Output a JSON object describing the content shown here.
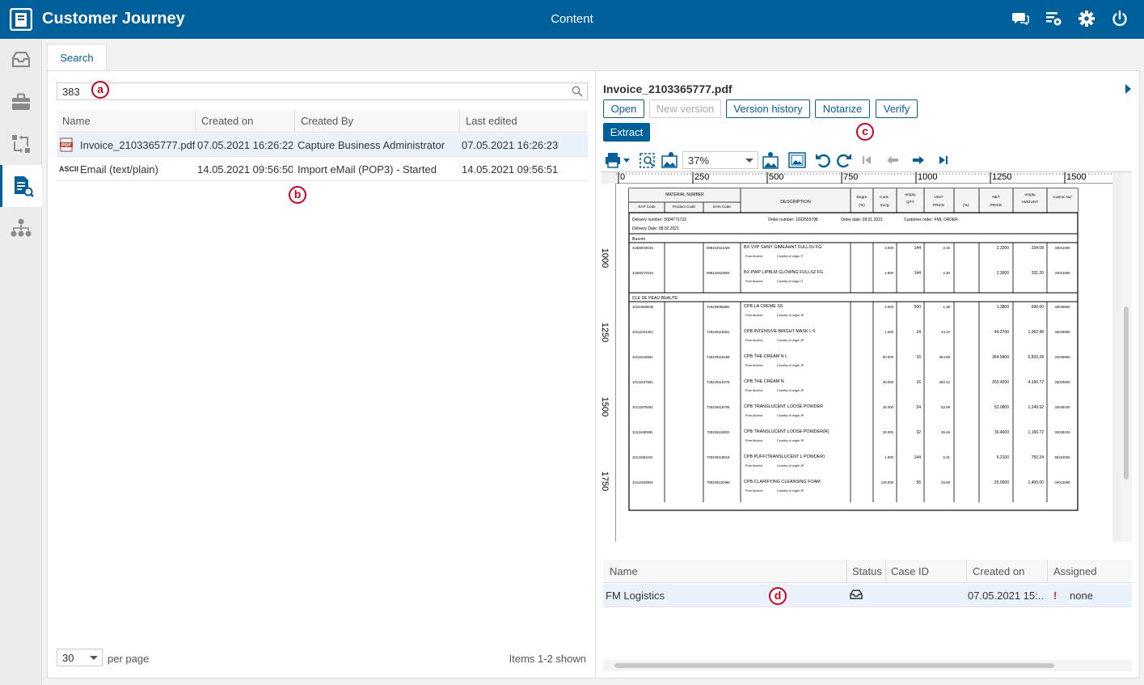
{
  "header": {
    "app_title": "Customer Journey",
    "section": "Content"
  },
  "tabs": [
    {
      "label": "Search"
    }
  ],
  "search": {
    "value": "383"
  },
  "result_table": {
    "columns": [
      "Name",
      "Created on",
      "Created By",
      "Last edited"
    ],
    "rows": [
      {
        "icon": "PDF",
        "name": "Invoice_2103365777.pdf",
        "created_on": "07.05.2021 16:26:22",
        "created_by": "Capture Business Administrator",
        "last_edited": "07.05.2021 16:26:23"
      },
      {
        "icon": "ASCII",
        "name": "Email (text/plain)",
        "created_on": "14.05.2021 09:56:50",
        "created_by": "Import eMail (POP3) - Started",
        "last_edited": "14.05.2021 09:56:51"
      }
    ]
  },
  "pagination": {
    "per_page_value": "30",
    "per_page_label": "per page",
    "items_shown": "Items 1-2 shown"
  },
  "markers": {
    "a": "a",
    "b": "b",
    "c": "c",
    "d": "d"
  },
  "document": {
    "title": "Invoice_2103365777.pdf",
    "buttons": {
      "open": "Open",
      "new_version": "New version",
      "version_history": "Version history",
      "notarize": "Notarize",
      "verify": "Verify",
      "extract": "Extract"
    },
    "zoom": "37%",
    "ruler_h": [
      "0",
      "250",
      "500",
      "750",
      "1000",
      "1250",
      "1500"
    ],
    "ruler_v": [
      "1000",
      "1250",
      "1500",
      "1750"
    ]
  },
  "invoice": {
    "headers": {
      "material_number": "MATERIAL NUMBER",
      "sap": "SAP Code",
      "product": "Product Code",
      "ean": "EAN Code",
      "description": "DESCRIPTION",
      "degre": "Degre",
      "degre_unit": "(%)",
      "cont": "Cont.",
      "cont_unit": "mL/g",
      "empty1": "empty",
      "qty": "QTY",
      "unit": "UNIT",
      "price": "PRICE",
      "pct": "(%)",
      "net": "NET",
      "net_price": "PRICE",
      "empty2": "empty",
      "amount": "AMOUNT",
      "custom": "Custom No/"
    },
    "delivery_number": "Delivery number: 3004771732",
    "order_number": "Order number: 1002555798",
    "order_date": "Order date: 28.01.2021",
    "customer_order": "Customer order: FML ORDER",
    "delivery_date": "Delivery Date:   08.02.2021",
    "note_alcohol": "Pure Alcohol",
    "note_country": "Country of origin JP",
    "note_country_it": "Country of origin IT",
    "groups": [
      {
        "brand": "Buxom",
        "rows": [
          {
            "sap": "41669039191",
            "ean": "098132521028",
            "desc": "BX VVP SHNY GIMEAHNT FULLSV FG",
            "cont": "3.000",
            "qty": "144",
            "unit": "2.32",
            "net": "2.3200",
            "amount": "334.08",
            "custom": "33041000"
          },
          {
            "sap": "41669270191",
            "ean": "098132523904",
            "desc": "BX PWP LIPBLM GLOWNG FULLSZ FG",
            "cont": "4.800",
            "qty": "144",
            "unit": "2.30",
            "net": "2.3000",
            "amount": "331.20",
            "custom": "33041000"
          }
        ]
      },
      {
        "brand": "CLE DE PEAU BEAUTE",
        "rows": [
          {
            "sap": "10104689030",
            "ean": "729239056892",
            "desc": "CPB LA CREME SS",
            "cont": "2.000",
            "qty": "500",
            "unit": "1.38",
            "net": "1.3800",
            "amount": "690.00",
            "custom": "33049900"
          },
          {
            "sap": "10111034301",
            "ean": "729239119361",
            "desc": "CPB INTENSIVE BRIGHT MASK L 6",
            "cont": "1.000",
            "qty": "24",
            "unit": "44.27",
            "net": "44.2700",
            "amount": "1,062.48",
            "custom": "33049900"
          },
          {
            "sap": "10111615591",
            "ean": "729239118188",
            "desc": "CPB THE CREAM N L",
            "cont": "50.000",
            "qty": "16",
            "unit": "364.58",
            "net": "364.5800",
            "amount": "5,833.28",
            "custom": "33049900"
          },
          {
            "sap": "10111637591",
            "ean": "729239118379",
            "desc": "CPB THE CREAM N",
            "cont": "30.000",
            "qty": "16",
            "unit": "260.42",
            "net": "260.4200",
            "amount": "4,166.72",
            "custom": "33049900"
          },
          {
            "sap": "10111975091",
            "ean": "729239118706",
            "desc": "CPB TRANSLUCENT LOOSE POWDER",
            "cont": "26.000",
            "qty": "24",
            "unit": "52.08",
            "net": "52.0800",
            "amount": "1,249.92",
            "custom": "33049100"
          },
          {
            "sap": "10111980091",
            "ean": "729239118802",
            "desc": "CPB TRANSLUCENT LOOSE POWDER(R)",
            "cont": "26.000",
            "qty": "32",
            "unit": "36.46",
            "net": "36.4600",
            "amount": "1,166.72",
            "custom": "33049100"
          },
          {
            "sap": "10111981192",
            "ean": "729239118819",
            "desc": "CPB PUFF(TRANSLUCENT L POWDER)",
            "cont": "1.000",
            "qty": "144",
            "unit": "5.21",
            "net": "5.2100",
            "amount": "750.24",
            "custom": "96162000"
          },
          {
            "sap": "10113238591",
            "ean": "799239130388",
            "desc": "CPB CLARIFYING CLEANSING FOAM",
            "cont": "116.000",
            "qty": "56",
            "unit": "25.00",
            "net": "25.0000",
            "amount": "1,400.00",
            "custom": "34012090"
          }
        ]
      }
    ]
  },
  "case_table": {
    "columns": [
      "Name",
      "Status",
      "Case ID",
      "Created on",
      "Assigned"
    ],
    "row": {
      "name": "FM Logistics",
      "case_id": "",
      "created_on": "07.05.2021 15:...",
      "flag": "!",
      "assigned": "none"
    }
  },
  "colors": {
    "brand": "#00609c",
    "marker": "#d0021b",
    "selected_row": "#e9f2fb"
  }
}
